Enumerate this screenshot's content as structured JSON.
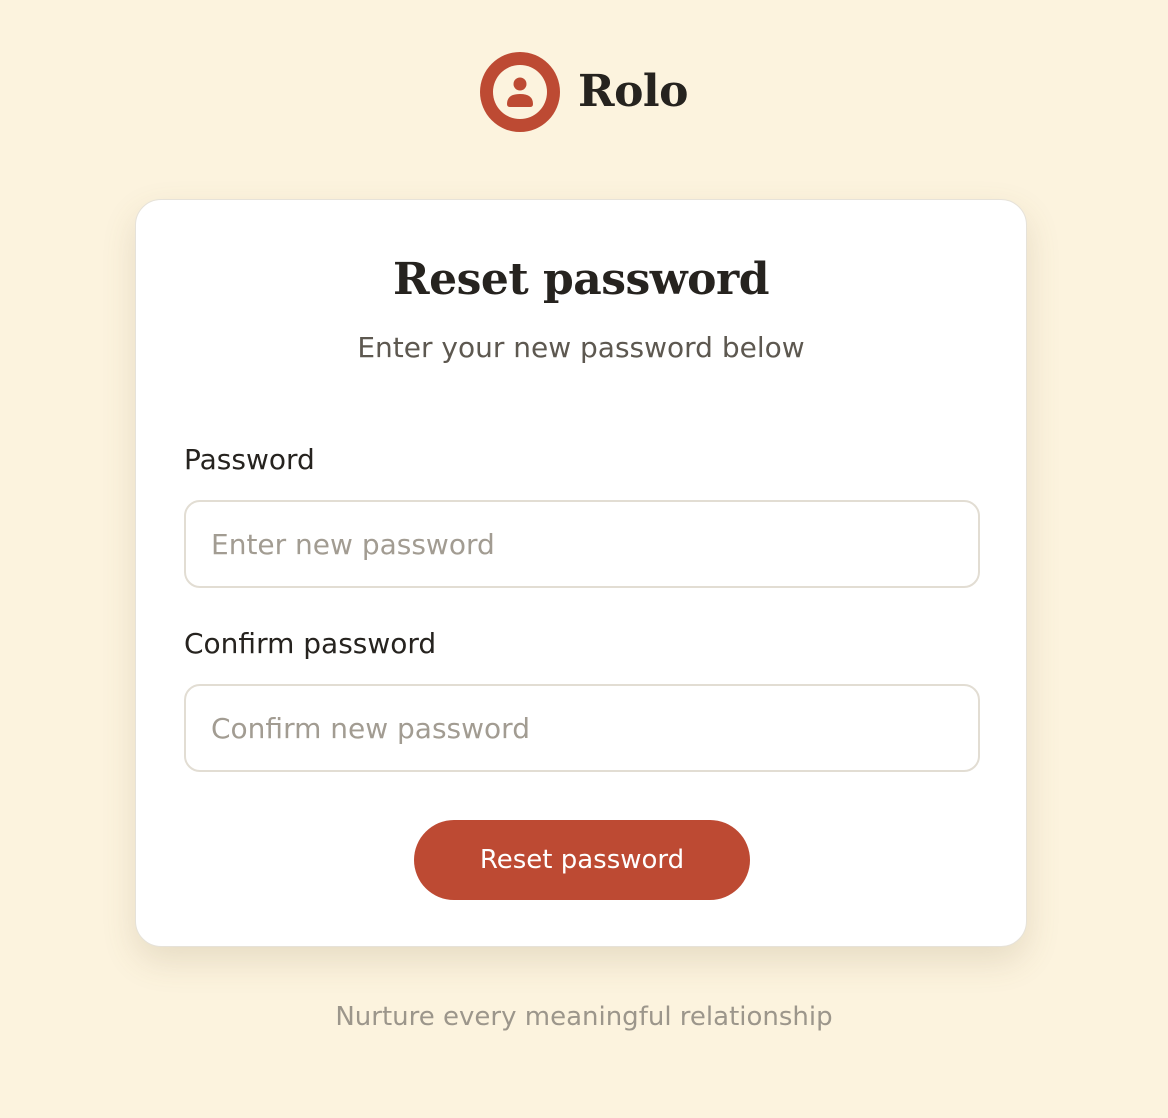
{
  "brand": {
    "name": "Rolo",
    "logo_icon": "person-circle-icon",
    "accent_color": "#bd4a33"
  },
  "form": {
    "title": "Reset password",
    "subtitle": "Enter your new password below",
    "password": {
      "label": "Password",
      "placeholder": "Enter new password",
      "value": ""
    },
    "confirm_password": {
      "label": "Confirm password",
      "placeholder": "Confirm new password",
      "value": ""
    },
    "submit_label": "Reset password"
  },
  "footer": {
    "tagline": "Nurture every meaningful relationship"
  },
  "colors": {
    "background": "#fcf3de",
    "card": "#ffffff",
    "text_primary": "#26231f",
    "text_secondary": "#5d5850",
    "text_muted": "#9c968b",
    "button": "#bd4a33"
  }
}
